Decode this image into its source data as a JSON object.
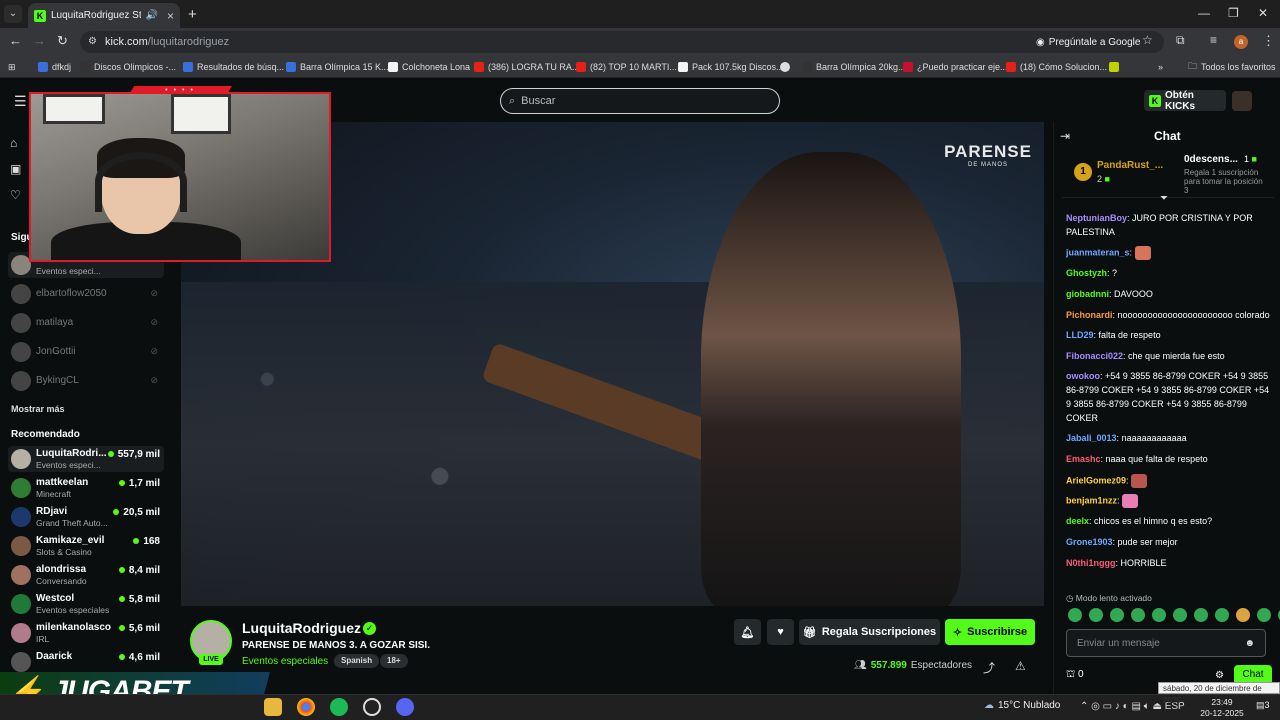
{
  "browser": {
    "tab_title": "LuquitaRodriguez Stream -",
    "url_host": "kick.com",
    "url_path": "/luquitarodriguez",
    "ask_google": "Pregúntale a Google",
    "profile_initial": "a",
    "bookmarks": [
      "dfkdj",
      "Discos Olimpicos -...",
      "Resultados de búsq...",
      "Barra Olímpica 15 K...",
      "Colchoneta Lona",
      "(386) LOGRA TU RA...",
      "(82) TOP 10 MARTI...",
      "Pack 107.5kg Discos...",
      "",
      "Barra Olímpica 20kg...",
      "¿Puedo practicar eje...",
      "(18) Cómo Solucion..."
    ],
    "bookmarks_all": "Todos los favoritos"
  },
  "kick": {
    "search_placeholder": "Buscar",
    "kicks_button": "Obtén KICKs"
  },
  "sidebar": {
    "following_heading": "Sigu",
    "first_followed_category": "Eventos especi...",
    "offline": [
      "elbartoflow2050",
      "matilaya",
      "JonGottii",
      "BykingCL"
    ],
    "show_more": "Mostrar más",
    "recommended_heading": "Recomendado",
    "recommended": [
      {
        "name": "LuquitaRodri...",
        "category": "Eventos especi...",
        "viewers": "557,9 mil"
      },
      {
        "name": "mattkeelan",
        "category": "Minecraft",
        "viewers": "1,7 mil"
      },
      {
        "name": "RDjavi",
        "category": "Grand Theft Auto...",
        "viewers": "20,5 mil"
      },
      {
        "name": "Kamikaze_evil",
        "category": "Slots & Casino",
        "viewers": "168"
      },
      {
        "name": "alondrissa",
        "category": "Conversando",
        "viewers": "8,4 mil"
      },
      {
        "name": "Westcol",
        "category": "Eventos especiales",
        "viewers": "5,8 mil"
      },
      {
        "name": "milenkanolasco",
        "category": "IRL",
        "viewers": "5,6 mil"
      },
      {
        "name": "Daarick",
        "category": "",
        "viewers": "4,6 mil"
      }
    ]
  },
  "video": {
    "overlay_brand": "PARENSE",
    "overlay_brand_sub": "DE MANOS"
  },
  "stream": {
    "channel": "LuquitaRodriguez",
    "live": "LIVE",
    "title": "PARENSE DE MANOS 3. A GOZAR SISI.",
    "category": "Eventos especiales",
    "tags": [
      "Spanish",
      "18+"
    ],
    "gift_label": "Regala Suscripciones",
    "subscribe_label": "Suscribirse",
    "viewers": "557.899",
    "viewers_label": "Espectadores"
  },
  "chat": {
    "title": "Chat",
    "leader1": {
      "rank": "1",
      "name": "PandaRust_...",
      "count": "2"
    },
    "leader2": {
      "name": "0descens...",
      "count": "1",
      "subtitle": "Regala 1 suscripción para tomar la posición 3"
    },
    "messages": [
      {
        "user": "NeptunianBoy",
        "color": "#a88cff",
        "text": "JURO POR CRISTINA Y POR PALESTINA"
      },
      {
        "user": "juanmateran_s",
        "color": "#6fa8ff",
        "text": "",
        "emote": "#d7745a"
      },
      {
        "user": "Ghostyzh",
        "color": "#53fc18",
        "text": "?"
      },
      {
        "user": "giobadnni",
        "color": "#53fc18",
        "text": "DAVOOO"
      },
      {
        "user": "Pichonardi",
        "color": "#ff9a3c",
        "text": "noooooooooooooooooooooo colorado"
      },
      {
        "user": "LLD29",
        "color": "#6fa8ff",
        "text": "falta de respeto"
      },
      {
        "user": "Fibonacci022",
        "color": "#a88cff",
        "text": "che que mierda fue esto"
      },
      {
        "user": "owokoo",
        "color": "#a88cff",
        "text": "+54 9 3855 86-8799 COKER +54 9 3855 86-8799 COKER +54 9 3855 86-8799 COKER +54 9 3855 86-8799 COKER +54 9 3855 86-8799 COKER"
      },
      {
        "user": "Jabali_0013",
        "color": "#6fa8ff",
        "text": "naaaaaaaaaaaa"
      },
      {
        "user": "Emashc",
        "color": "#ff5b77",
        "text": "naaa que falta de respeto"
      },
      {
        "user": "ArielGomez09",
        "color": "#ffd23c",
        "text": "",
        "emote": "#b8564e"
      },
      {
        "user": "benjam1nzz",
        "color": "#ffd23c",
        "text": "",
        "emote": "#e87fb4"
      },
      {
        "user": "deelx",
        "color": "#53fc18",
        "text": "chicos es el himno q es esto?"
      },
      {
        "user": "Grone1903",
        "color": "#6fa8ff",
        "text": "pude ser mejor"
      },
      {
        "user": "N0thi1nggg",
        "color": "#ff5b77",
        "text": "HORRIBLE"
      }
    ],
    "slow_mode": "Modo lento activado",
    "input_placeholder": "Enviar un mensaje",
    "points": "0",
    "send_label": "Chat"
  },
  "overlay": {
    "brand": "JUGABET"
  },
  "taskbar": {
    "weather": "15°C  Nublado",
    "lang": "ESP",
    "time": "23:49",
    "date": "20-12-2025",
    "date_tooltip": "sábado, 20 de diciembre de 2025",
    "notifications": "3"
  },
  "colors": {
    "accent": "#53fc18",
    "webcam_border": "#e01a28"
  }
}
